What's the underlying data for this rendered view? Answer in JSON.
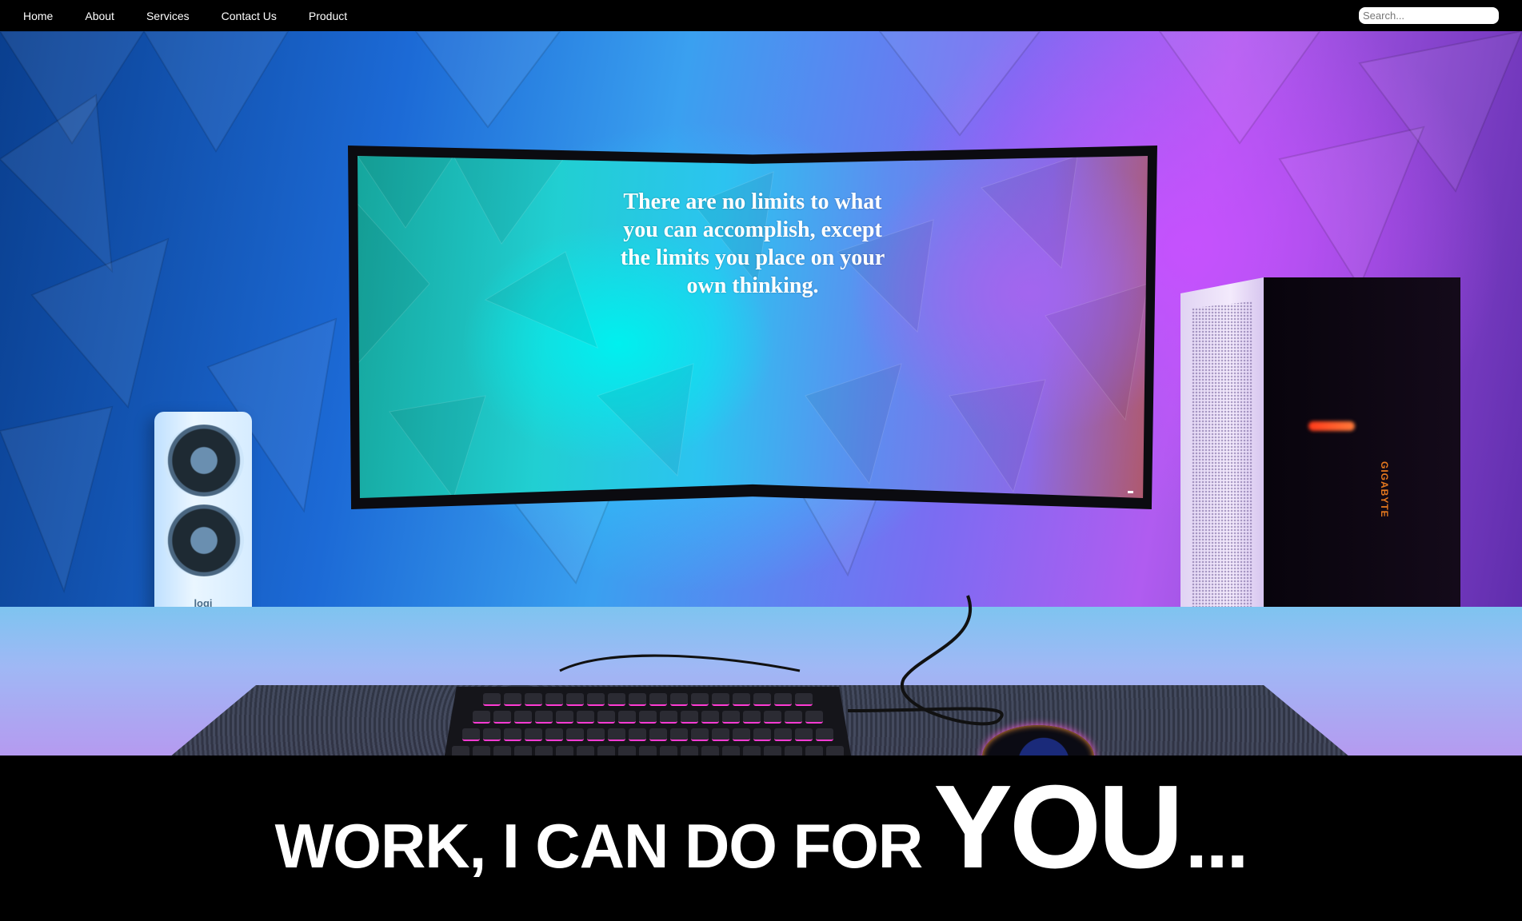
{
  "nav": {
    "items": [
      {
        "label": "Home"
      },
      {
        "label": "About"
      },
      {
        "label": "Services"
      },
      {
        "label": "Contact Us"
      },
      {
        "label": "Product"
      }
    ],
    "search_placeholder": "Search..."
  },
  "hero": {
    "quote": "There are no limits to what you can accomplish, except the limits you place on your own thinking.",
    "speaker_brand": "logi",
    "case_brand": "GIGABYTE"
  },
  "banner": {
    "text_small": "WORK, I CAN DO FOR",
    "text_big": "YOU",
    "text_dots": "..."
  },
  "colors": {
    "nav_bg": "#000000",
    "banner_bg": "#000000",
    "text": "#ffffff"
  }
}
